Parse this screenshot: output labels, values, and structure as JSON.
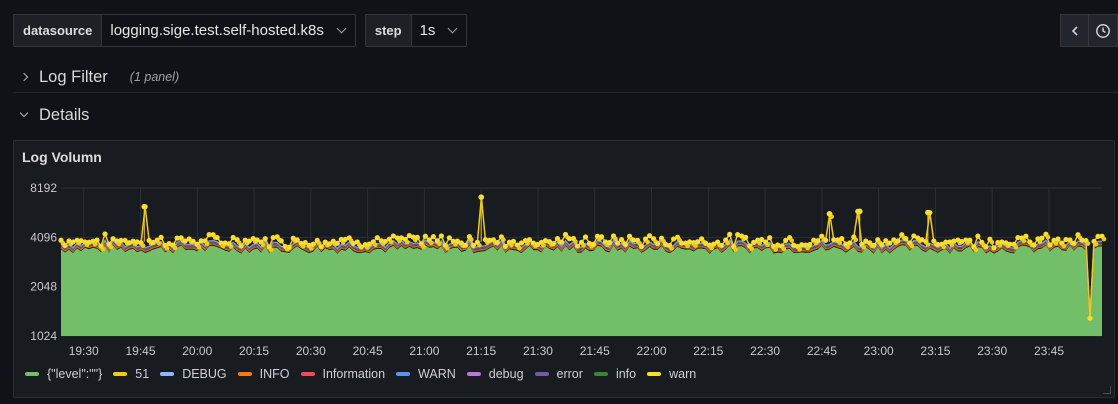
{
  "variables": [
    {
      "label": "datasource",
      "value": "logging.sige.test.self-hosted.k8s"
    },
    {
      "label": "step",
      "value": "1s"
    }
  ],
  "rows": [
    {
      "title": "Log Filter",
      "count": "(1 panel)",
      "collapsed": true
    },
    {
      "title": "Details",
      "collapsed": false
    }
  ],
  "panel": {
    "title": "Log Volumn"
  },
  "icons": {
    "back": "chevron-left-icon",
    "time": "clock-icon"
  },
  "chart_data": {
    "type": "area",
    "title": "Log Volumn",
    "y_scale": "log2",
    "ylim": [
      1024,
      8192
    ],
    "y_ticks": [
      "8192",
      "4096",
      "2048",
      "1024"
    ],
    "x_ticks": [
      "19:30",
      "19:45",
      "20:00",
      "20:15",
      "20:30",
      "20:45",
      "21:00",
      "21:15",
      "21:30",
      "21:45",
      "22:00",
      "22:15",
      "22:30",
      "22:45",
      "23:00",
      "23:15",
      "23:30",
      "23:45"
    ],
    "x_range": [
      "19:24",
      "23:59"
    ],
    "stacked_total_approx": 4000,
    "main_series_approx": 3500,
    "spikes": [
      {
        "x": "19:46",
        "y": 6300
      },
      {
        "x": "21:15",
        "y": 7200
      },
      {
        "x": "22:47",
        "y": 5700
      },
      {
        "x": "22:55",
        "y": 5900
      },
      {
        "x": "23:13",
        "y": 5800
      },
      {
        "x": "23:56",
        "y": 1250
      }
    ],
    "legend_position": "bottom-left",
    "grid": true,
    "series": [
      {
        "name": "{\"level\":\"\"}",
        "color": "#73bf69"
      },
      {
        "name": "51",
        "color": "#f2cc0c"
      },
      {
        "name": "DEBUG",
        "color": "#8ab8ff"
      },
      {
        "name": "INFO",
        "color": "#ff780a"
      },
      {
        "name": "Information",
        "color": "#f2495c"
      },
      {
        "name": "WARN",
        "color": "#5794f2"
      },
      {
        "name": "debug",
        "color": "#b877d9"
      },
      {
        "name": "error",
        "color": "#705da0"
      },
      {
        "name": "info",
        "color": "#37872d"
      },
      {
        "name": "warn",
        "color": "#fade2a"
      }
    ]
  }
}
